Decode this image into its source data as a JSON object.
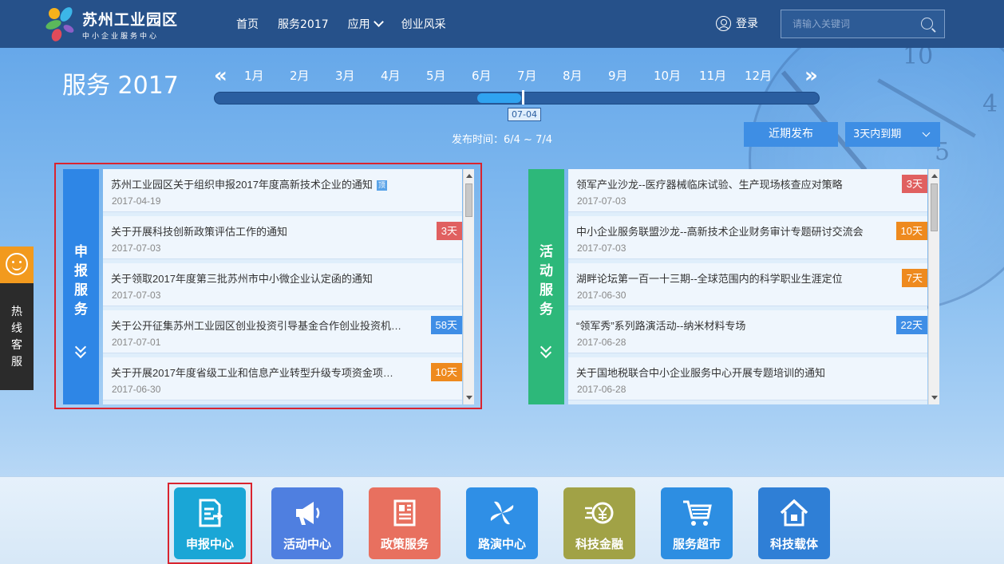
{
  "header": {
    "logo_title": "苏州工业园区",
    "logo_sub": "中小企业服务中心",
    "nav": [
      {
        "label": "首页"
      },
      {
        "label": "服务2017"
      },
      {
        "label": "应用"
      },
      {
        "label": "创业风采"
      }
    ],
    "login_label": "登录",
    "search_placeholder": "请输入关键词"
  },
  "timeline": {
    "title": "服务 2017",
    "months": [
      "1月",
      "2月",
      "3月",
      "4月",
      "5月",
      "6月",
      "7月",
      "8月",
      "9月",
      "10月",
      "11月",
      "12月"
    ],
    "prev": "«",
    "next": "»",
    "current_date": "07-04",
    "range_start_fraction": 0.435,
    "range_end_fraction": 0.508,
    "publish_time": "发布时间：6/4 ~ 7/4",
    "recent_button": "近期发布",
    "expire_filter": "3天内到期"
  },
  "colors": {
    "nav_bg": "#26518a",
    "declare_tab": "#2e86e6",
    "activity_tab": "#2db87a",
    "badge_red": "#e06060",
    "badge_orange": "#ee8a1e",
    "badge_blue": "#3f8ee6",
    "highlight": "#d9242f"
  },
  "declare_panel": {
    "tab_label": [
      "申",
      "报",
      "服",
      "务"
    ],
    "items": [
      {
        "title": "苏州工业园区关于组织申报2017年度高新技术企业的通知",
        "date": "2017-04-19",
        "tag": "顶",
        "badge": ""
      },
      {
        "title": "关于开展科技创新政策评估工作的通知",
        "date": "2017-07-03",
        "badge": "3天",
        "badge_color": "red"
      },
      {
        "title": "关于领取2017年度第三批苏州市中小微企业认定函的通知",
        "date": "2017-07-03",
        "badge": ""
      },
      {
        "title": "关于公开征集苏州工业园区创业投资引导基金合作创业投资机…",
        "date": "2017-07-01",
        "badge": "58天",
        "badge_color": "blue"
      },
      {
        "title": "关于开展2017年度省级工业和信息产业转型升级专项资金项…",
        "date": "2017-06-30",
        "badge": "10天",
        "badge_color": "orange"
      }
    ]
  },
  "activity_panel": {
    "tab_label": [
      "活",
      "动",
      "服",
      "务"
    ],
    "items": [
      {
        "title": "领军产业沙龙--医疗器械临床试验、生产现场核查应对策略",
        "date": "2017-07-03",
        "badge": "3天",
        "badge_color": "red"
      },
      {
        "title": "中小企业服务联盟沙龙--高新技术企业财务审计专题研讨交流会",
        "date": "2017-07-03",
        "badge": "10天",
        "badge_color": "orange"
      },
      {
        "title": "湖畔论坛第一百一十三期--全球范围内的科学职业生涯定位",
        "date": "2017-06-30",
        "badge": "7天",
        "badge_color": "orange"
      },
      {
        "title": "“领军秀”系列路演活动--纳米材料专场",
        "date": "2017-06-28",
        "badge": "22天",
        "badge_color": "blue"
      },
      {
        "title": "关于国地税联合中小企业服务中心开展专题培训的通知",
        "date": "2017-06-28",
        "badge": ""
      }
    ]
  },
  "hotline": {
    "label": [
      "热",
      "线",
      "客",
      "服"
    ]
  },
  "bottom_nav": [
    {
      "label": "申报中心",
      "color": "#1aa6d6",
      "icon": "document-icon"
    },
    {
      "label": "活动中心",
      "color": "#4f7fe0",
      "icon": "megaphone-icon"
    },
    {
      "label": "政策服务",
      "color": "#e8705f",
      "icon": "newspaper-icon"
    },
    {
      "label": "路演中心",
      "color": "#2f8fe6",
      "icon": "pinwheel-icon"
    },
    {
      "label": "科技金融",
      "color": "#a1a246",
      "icon": "yen-coin-icon"
    },
    {
      "label": "服务超市",
      "color": "#2d8ee2",
      "icon": "cart-icon"
    },
    {
      "label": "科技载体",
      "color": "#2f7fd6",
      "icon": "house-icon"
    }
  ]
}
